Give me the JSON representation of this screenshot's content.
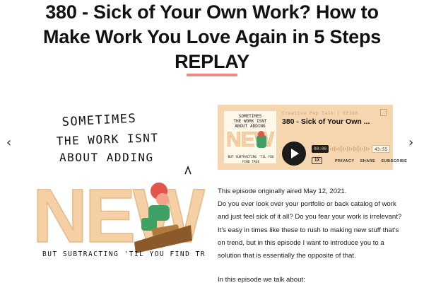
{
  "header": {
    "title": "380 - Sick of Your Own Work? How to Make Work You Love Again in 5 Steps REPLAY"
  },
  "nav": {
    "prev_label": "‹",
    "next_label": "›"
  },
  "artwork": {
    "line1": "SOMETIMES",
    "line2": "THE WORK ISNT",
    "line3": "ABOUT ADDING",
    "big_word": "NEW",
    "caption": "BUT SUBTRACTING 'TIL YOU FIND TRUE"
  },
  "player": {
    "show_name": "Creative Pep Talk | EP380",
    "episode_title": "380 - Sick of Your Own ...",
    "elapsed": "00:00",
    "remaining": "43:55",
    "speed": "1X",
    "links": [
      "PRIVACY",
      "SHARE",
      "SUBSCRIBE"
    ],
    "cover_line1": "SOMETIMES",
    "cover_line2": "THE WORK ISNT",
    "cover_line3": "ABOUT ADDING",
    "cover_big": "NEW",
    "cover_caption": "BUT SUBTRACTING 'TIL YOU FIND TRUE"
  },
  "description": {
    "p1": "This episode originally aired May 12, 2021.",
    "p2": "Do you ever look over your portfolio or back catalog of work and just feel sick of it all? Do you fear your work is irrelevant? It's easy in times like these to rush to making new stuff that's on trend, but in this episode I want to introduce you to a solution that is essentially the opposite of that.",
    "p3": "In this episode we talk about:"
  },
  "colors": {
    "accent": "#ee8a80",
    "player_bg": "#f6d6ae",
    "art_fill": "#f4d0a4"
  }
}
